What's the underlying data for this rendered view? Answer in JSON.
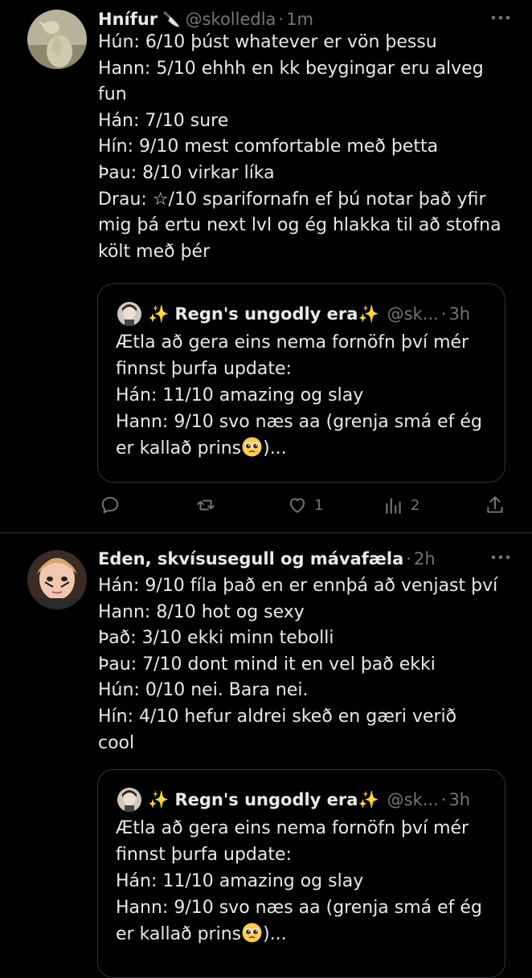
{
  "tweets": [
    {
      "author_name": "Hnífur",
      "author_emoji": "🔪",
      "handle": "@skolledla",
      "separator": "·",
      "time": "1m",
      "lines": [
        "Hún: 6/10 þúst whatever er vön þessu",
        "Hann: 5/10 ehhh en kk beygingar eru alveg",
        "fun",
        "Hán: 7/10 sure",
        "Hín: 9/10 mest comfortable með þetta",
        "Þau: 8/10 virkar líka",
        "Drau: ☆/10 sparifornafn ef þú notar það yfir",
        "mig þá ertu next lvl og ég hlakka til að stofna",
        "költ með þér"
      ],
      "quote": {
        "author_name": "✨ Regn's ungodly era✨",
        "handle": "@sk...",
        "separator": "·",
        "time": "3h",
        "lines": [
          "Ætla að gera eins nema fornöfn því mér",
          "finnst þurfa update:",
          "Hán: 11/10 amazing og slay",
          "Hann: 9/10 svo næs aa (grenja smá ef ég"
        ],
        "last_line_before_emoji": "er kallað prins",
        "last_line_after_emoji": ")...",
        "emoji_icon": "pleading-face-emoji"
      },
      "actions": {
        "reply_count": "",
        "retweet_count": "",
        "like_count": "1",
        "views_count": "2"
      }
    },
    {
      "author_name": "Eden, skvísusegull og mávafæla",
      "handle": "",
      "separator": "·",
      "time": "2h",
      "lines": [
        "Hán: 9/10 fíla það en er ennþá að venjast því",
        "Hann: 8/10 hot og sexy",
        "Það: 3/10 ekki minn tebolli",
        "Þau: 7/10 dont mind it en vel það ekki",
        "Hún: 0/10 nei. Bara nei.",
        "Hín: 4/10 hefur aldrei skeð en gæri verið",
        "cool"
      ],
      "quote": {
        "author_name": "✨ Regn's ungodly era✨",
        "handle": "@sk...",
        "separator": "·",
        "time": "3h",
        "lines": [
          "Ætla að gera eins nema fornöfn því mér",
          "finnst þurfa update:",
          "Hán: 11/10 amazing og slay",
          "Hann: 9/10 svo næs aa (grenja smá ef ég"
        ],
        "last_line_before_emoji": "er kallað prins",
        "last_line_after_emoji": ")...",
        "emoji_icon": "pleading-face-emoji"
      }
    }
  ],
  "colors": {
    "background": "#000000",
    "text_primary": "#e7e9ea",
    "text_secondary": "#71767b",
    "border": "#2f3336"
  },
  "icons": [
    "more-icon",
    "reply-icon",
    "retweet-icon",
    "like-icon",
    "views-icon",
    "share-icon",
    "pleading-face-emoji"
  ]
}
